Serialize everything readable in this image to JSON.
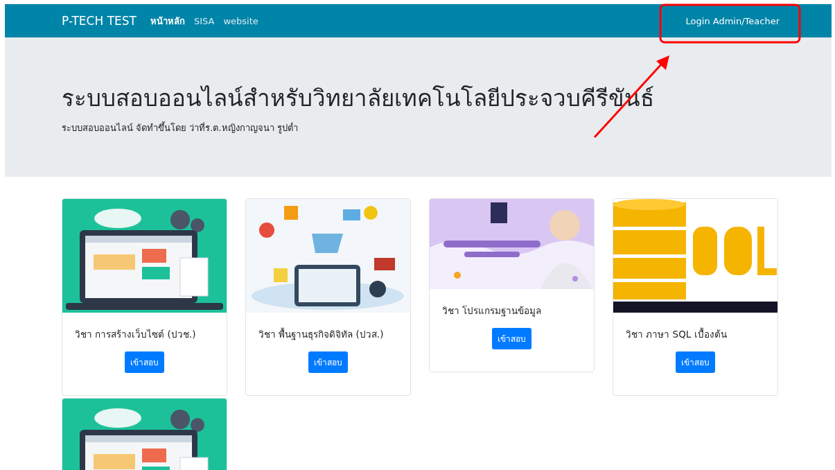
{
  "navbar": {
    "brand": "P-TECH TEST",
    "links": [
      {
        "label": "หน้าหลัก",
        "selected": true
      },
      {
        "label": "SISA",
        "selected": false
      },
      {
        "label": "website",
        "selected": false
      }
    ],
    "login": "Login Admin/Teacher"
  },
  "hero": {
    "title": "ระบบสอบออนไลน์สำหรับวิทยาลัยเทคโนโลยีประจวบคีรีขันธ์",
    "subtitle": "ระบบสอบออนไลน์ จัดทำขึ้นโดย ว่าที่ร.ต.หญิงกาญจนา รูปต่ำ"
  },
  "cards": [
    {
      "image": {
        "kind": "picture"
      },
      "title": "วิชา การสร้างเว็บไซต์ (ปวช.)",
      "button": "เข้าสอบ"
    },
    {
      "image": {
        "kind": "picture"
      },
      "title": "วิชา พื้นฐานธุรกิจดิจิทัล (ปวส.)",
      "button": "เข้าสอบ"
    },
    {
      "image": {
        "kind": "picture"
      },
      "title": "วิชา โปรแกรมฐานข้อมูล",
      "button": "เข้าสอบ"
    },
    {
      "image": {
        "kind": "picture"
      },
      "title": "วิชา ภาษา SQL เบื้องต้น",
      "button": "เข้าสอบ"
    },
    {
      "image": {
        "kind": "picture"
      }
    }
  ]
}
